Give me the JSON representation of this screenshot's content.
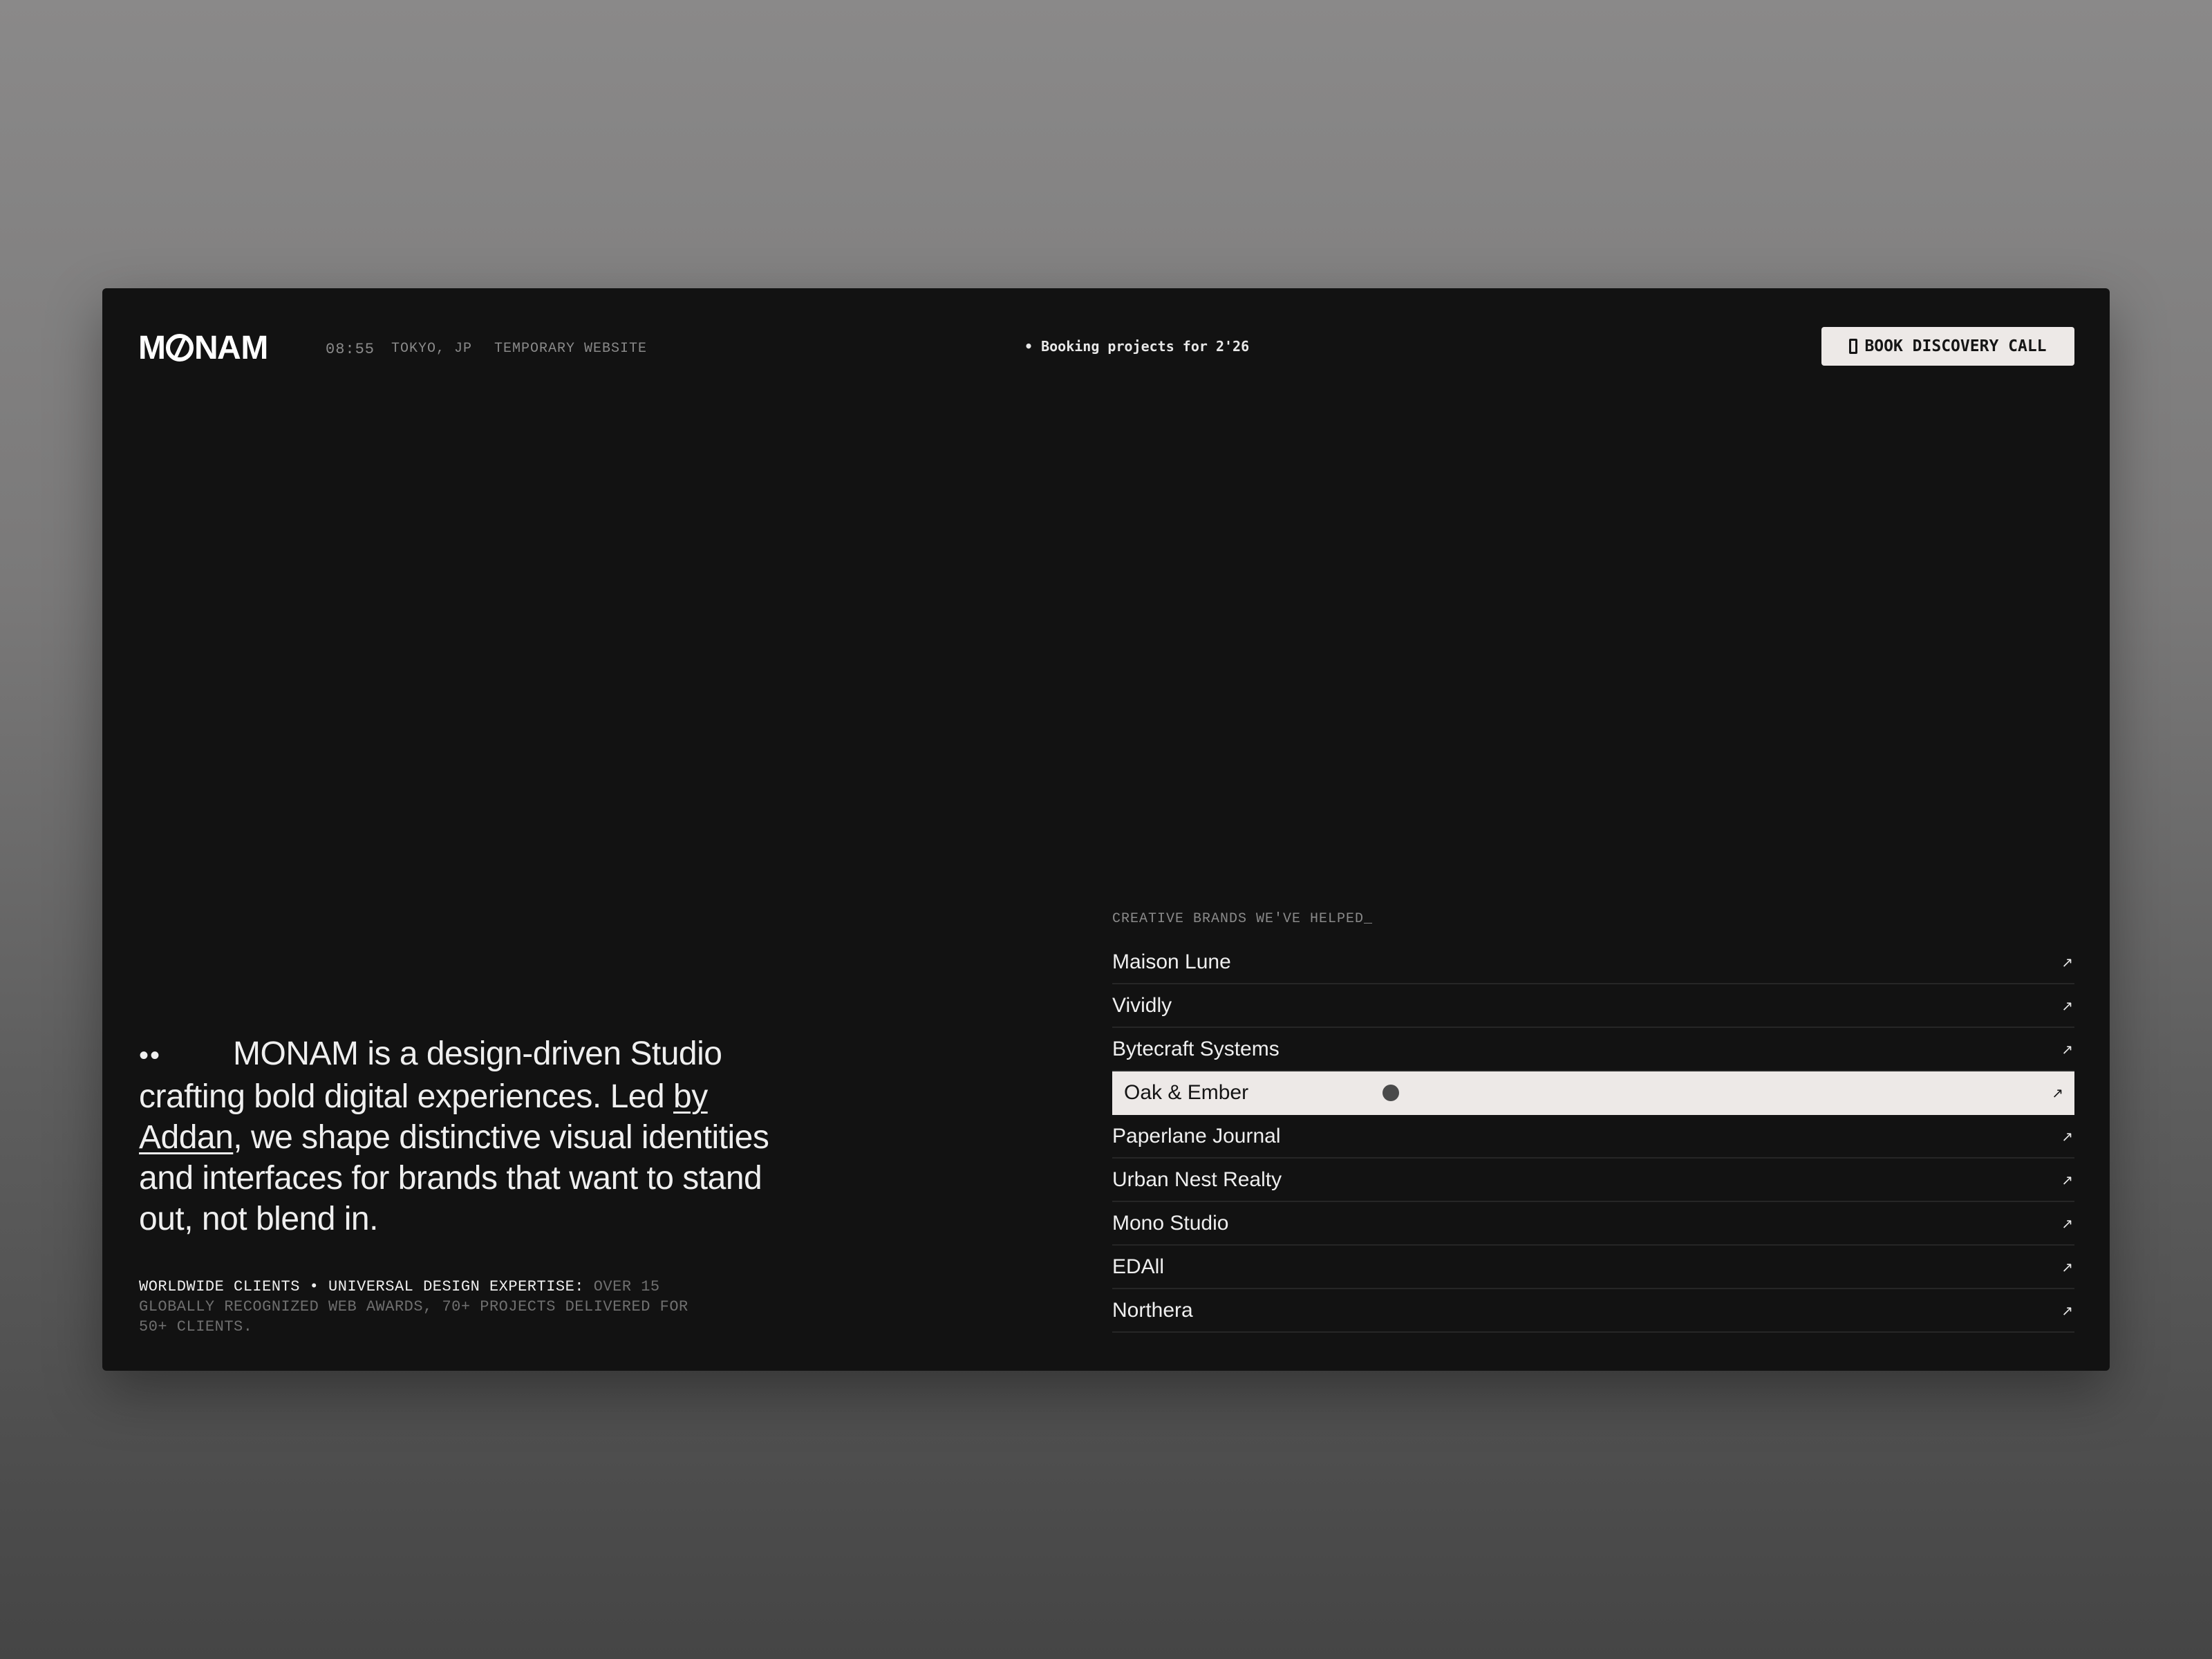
{
  "header": {
    "logo_text": "MONAM",
    "time": "08:55",
    "location": "TOKYO, JP",
    "site_status": "TEMPORARY WEBSITE",
    "booking": "• Booking projects for 2'26",
    "cta_label": "BOOK DISCOVERY CALL",
    "cta_icon": "phone-icon"
  },
  "hero": {
    "dots": "••",
    "text_before_link": "MONAM is a design-driven Studio crafting bold digital experiences. Led ",
    "link_text": "by Addan",
    "text_after_link": ", we shape distinctive visual identities and interfaces for brands that want to stand out, not blend in."
  },
  "facts": {
    "highlight": "WORLDWIDE CLIENTS • UNIVERSAL DESIGN EXPERTISE:",
    "detail": "OVER 15 GLOBALLY RECOGNIZED WEB AWARDS, 70+ PROJECTS DELIVERED FOR 50+ CLIENTS."
  },
  "brands": {
    "title": "CREATIVE BRANDS WE'VE HELPED_",
    "arrow_icon": "arrow-up-right-icon",
    "arrow_glyph": "↗",
    "active_index": 3,
    "items": [
      {
        "name": "Maison Lune"
      },
      {
        "name": "Vividly"
      },
      {
        "name": "Bytecraft Systems"
      },
      {
        "name": "Oak & Ember"
      },
      {
        "name": "Paperlane Journal"
      },
      {
        "name": "Urban Nest Realty"
      },
      {
        "name": "Mono Studio"
      },
      {
        "name": "EDAll"
      },
      {
        "name": "Northera"
      }
    ]
  },
  "colors": {
    "page_bg": "#121212",
    "text": "#efefef",
    "muted": "#8a8a8a",
    "highlight_bg": "#ede9e7"
  }
}
